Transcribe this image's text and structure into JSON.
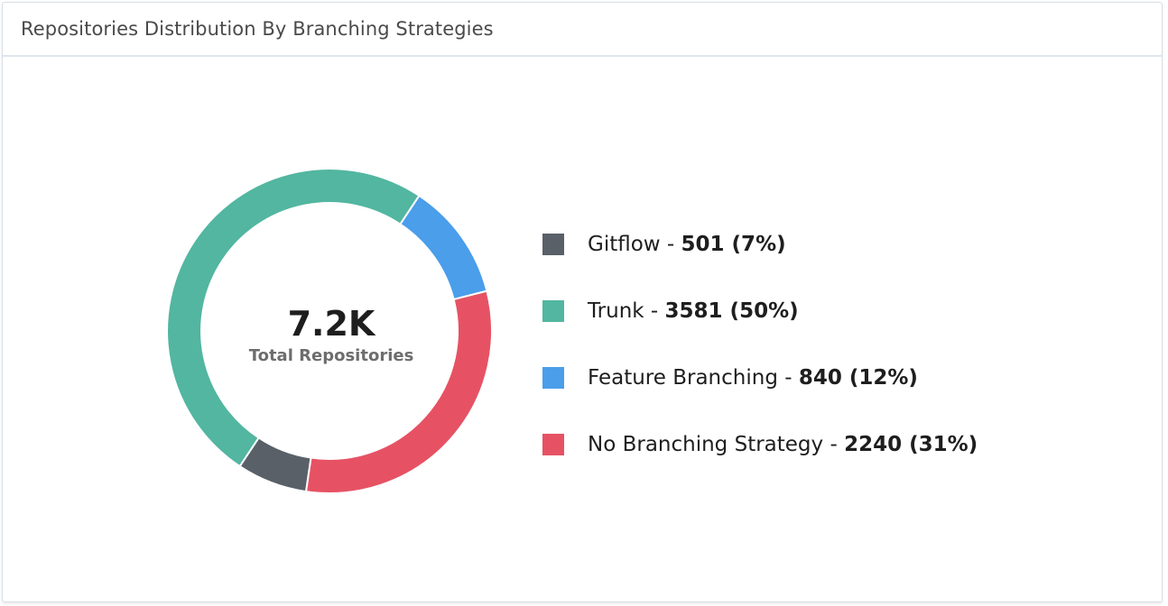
{
  "header": {
    "title": "Repositories Distribution By Branching Strategies"
  },
  "center": {
    "value": "7.2K",
    "label": "Total Repositories"
  },
  "chart_data": {
    "type": "pie",
    "title": "Repositories Distribution By Branching Strategies",
    "total_label": "7.2K",
    "slices": [
      {
        "name": "Gitflow",
        "value": 501,
        "percent": 7,
        "color": "#5a6068",
        "legend_name": "Gitflow - ",
        "legend_value": "501 (7%)"
      },
      {
        "name": "Trunk",
        "value": 3581,
        "percent": 50,
        "color": "#52b6a0",
        "legend_name": "Trunk - ",
        "legend_value": "3581 (50%)"
      },
      {
        "name": "Feature Branching",
        "value": 840,
        "percent": 12,
        "color": "#4a9eea",
        "legend_name": "Feature Branching - ",
        "legend_value": "840 (12%)"
      },
      {
        "name": "No Branching Strategy",
        "value": 2240,
        "percent": 31,
        "color": "#e65264",
        "legend_name": "No Branching Strategy - ",
        "legend_value": "2240 (31%)"
      }
    ]
  }
}
